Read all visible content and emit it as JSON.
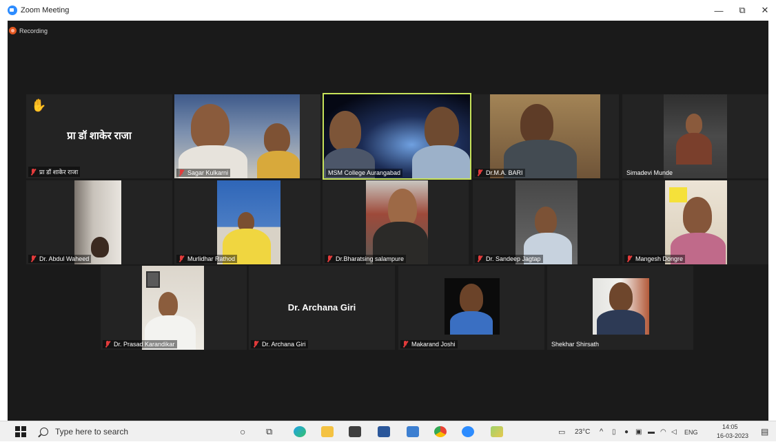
{
  "window": {
    "title": "Zoom Meeting",
    "minimize": "—",
    "maximize": "⧉",
    "close": "✕"
  },
  "meeting": {
    "recording_label": "Recording",
    "featured_center_name": "प्रा डॉ शाकेर राजा",
    "participants": [
      {
        "name": "प्रा डॉ शाकेर राजा",
        "muted": true,
        "hand_raised": true
      },
      {
        "name": "Sagar Kulkarni",
        "muted": true
      },
      {
        "name": "MSM College Aurangabad",
        "muted": false,
        "active_speaker": true
      },
      {
        "name": "Dr.M.A. BARI",
        "muted": true
      },
      {
        "name": "Simadevi Munde",
        "muted": false
      },
      {
        "name": "Dr. Abdul Waheed",
        "muted": true
      },
      {
        "name": "Murlidhar Rathod",
        "muted": true
      },
      {
        "name": "Dr.Bharatsing salampure",
        "muted": true
      },
      {
        "name": "Dr. Sandeep Jagtap",
        "muted": true
      },
      {
        "name": "Mangesh Dongre",
        "muted": true
      },
      {
        "name": "Dr. Prasad Karandikar",
        "muted": true
      },
      {
        "name": "Dr. Archana Giri",
        "muted": true
      },
      {
        "name": "Makarand Joshi",
        "muted": true
      },
      {
        "name": "Shekhar Shirsath",
        "muted": false
      }
    ],
    "archana_center_name": "Dr. Archana Giri"
  },
  "taskbar": {
    "search_placeholder": "Type here to search",
    "weather": "23°C",
    "language": "ENG",
    "time": "14:05",
    "date": "16-03-2023"
  }
}
